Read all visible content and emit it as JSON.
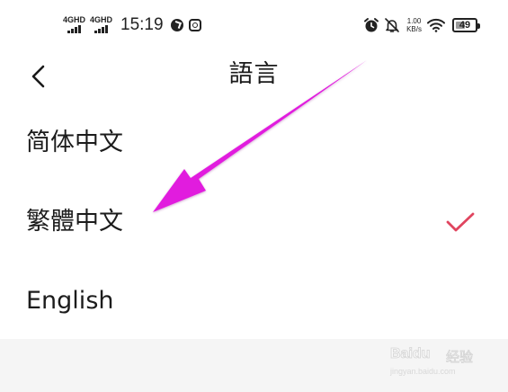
{
  "status_bar": {
    "network": [
      {
        "label": "4GHD",
        "bars": 4
      },
      {
        "label": "4GHD",
        "bars": 4
      }
    ],
    "time": "15:19",
    "left_icons": [
      "navigation-app-icon",
      "browser-app-icon"
    ],
    "right_icons": [
      "alarm-icon",
      "notifications-off-icon",
      "wifi-icon"
    ],
    "speed_value": "1.00",
    "speed_unit": "KB/s",
    "battery_level": "49"
  },
  "header": {
    "back_icon": "chevron-left-icon",
    "title": "語言"
  },
  "languages": [
    {
      "label": "简体中文",
      "selected": false
    },
    {
      "label": "繁體中文",
      "selected": true
    },
    {
      "label": "English",
      "selected": false
    }
  ],
  "colors": {
    "checkmark": "#e0455f",
    "annotation_arrow": "#e11fde",
    "background": "#ffffff",
    "footer_background": "#f5f5f5"
  },
  "watermark": {
    "text": "Baidu",
    "text2": "经验",
    "url": "jingyan.baidu.com"
  }
}
